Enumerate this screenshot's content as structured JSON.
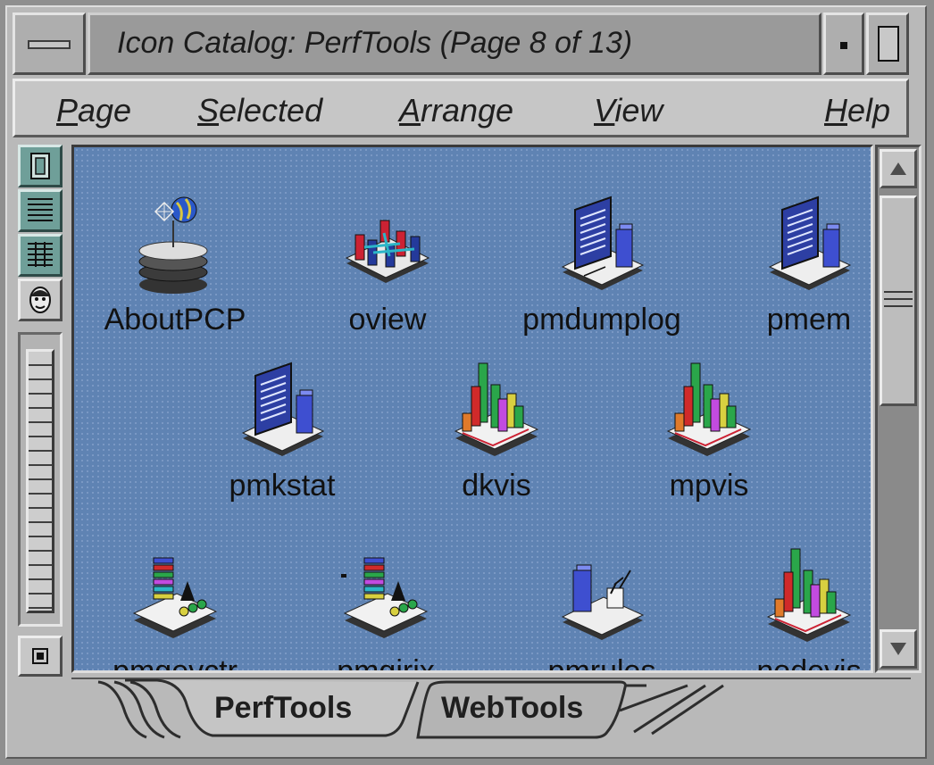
{
  "window": {
    "title": "Icon Catalog: PerfTools (Page 8 of 13)"
  },
  "menubar": {
    "items": [
      {
        "label": "Page",
        "mnemonic": "P",
        "rest": "age"
      },
      {
        "label": "Selected",
        "mnemonic": "S",
        "rest": "elected"
      },
      {
        "label": "Arrange",
        "mnemonic": "A",
        "rest": "rrange"
      },
      {
        "label": "View",
        "mnemonic": "V",
        "rest": "iew"
      },
      {
        "label": "Help",
        "mnemonic": "H",
        "rest": "elp"
      }
    ]
  },
  "view_buttons": [
    {
      "icon": "single-icon-view-icon"
    },
    {
      "icon": "list-view-icon"
    },
    {
      "icon": "detail-view-icon"
    },
    {
      "icon": "face-icon"
    }
  ],
  "icons": [
    {
      "label": "AboutPCP",
      "icon": "about-pcp-icon"
    },
    {
      "label": "oview",
      "icon": "oview-icon"
    },
    {
      "label": "pmdumplog",
      "icon": "pmdumplog-icon"
    },
    {
      "label": "pmem",
      "icon": "pmem-icon"
    },
    {
      "label": "pmkstat",
      "icon": "pmkstat-icon"
    },
    {
      "label": "dkvis",
      "icon": "dkvis-icon"
    },
    {
      "label": "mpvis",
      "icon": "mpvis-icon"
    },
    {
      "label": "pmgevctr",
      "icon": "pmgevctr-icon"
    },
    {
      "label": "pmgirix",
      "icon": "pmgirix-icon"
    },
    {
      "label": "pmrules",
      "icon": "pmrules-icon"
    },
    {
      "label": "nodevis",
      "icon": "nodevis-icon"
    }
  ],
  "tabs": [
    {
      "label": "PerfTools",
      "active": true
    },
    {
      "label": "WebTools",
      "active": false
    }
  ],
  "colors": {
    "icon_area_bg": "#5f83b3",
    "view_button": "#6f9f99",
    "chrome": "#b9b9b9"
  }
}
